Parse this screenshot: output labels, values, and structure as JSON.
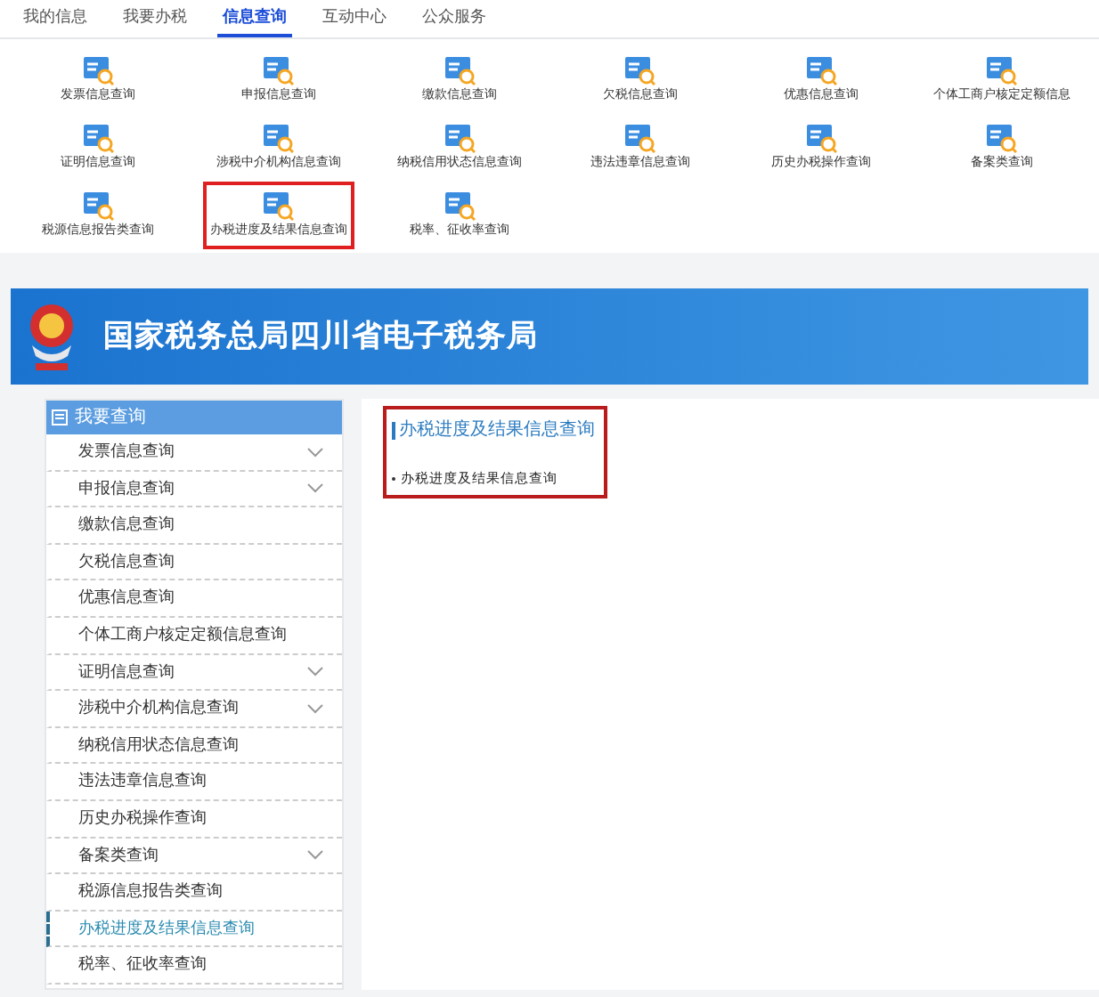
{
  "tabs": [
    {
      "label": "我的信息",
      "selected": false
    },
    {
      "label": "我要办税",
      "selected": false
    },
    {
      "label": "信息查询",
      "selected": true
    },
    {
      "label": "互动中心",
      "selected": false
    },
    {
      "label": "公众服务",
      "selected": false
    }
  ],
  "grid": [
    {
      "label": "发票信息查询",
      "highlighted": false
    },
    {
      "label": "申报信息查询",
      "highlighted": false
    },
    {
      "label": "缴款信息查询",
      "highlighted": false
    },
    {
      "label": "欠税信息查询",
      "highlighted": false
    },
    {
      "label": "优惠信息查询",
      "highlighted": false
    },
    {
      "label": "个体工商户核定定额信息",
      "highlighted": false
    },
    {
      "label": "证明信息查询",
      "highlighted": false
    },
    {
      "label": "涉税中介机构信息查询",
      "highlighted": false
    },
    {
      "label": "纳税信用状态信息查询",
      "highlighted": false
    },
    {
      "label": "违法违章信息查询",
      "highlighted": false
    },
    {
      "label": "历史办税操作查询",
      "highlighted": false
    },
    {
      "label": "备案类查询",
      "highlighted": false
    },
    {
      "label": "税源信息报告类查询",
      "highlighted": false
    },
    {
      "label": "办税进度及结果信息查询",
      "highlighted": true
    },
    {
      "label": "税率、征收率查询",
      "highlighted": false
    }
  ],
  "banner": {
    "title": "国家税务总局四川省电子税务局"
  },
  "sidebar": {
    "title": "我要查询",
    "items": [
      {
        "label": "发票信息查询",
        "expandable": true,
        "selected": false
      },
      {
        "label": "申报信息查询",
        "expandable": true,
        "selected": false
      },
      {
        "label": "缴款信息查询",
        "expandable": false,
        "selected": false
      },
      {
        "label": "欠税信息查询",
        "expandable": false,
        "selected": false
      },
      {
        "label": "优惠信息查询",
        "expandable": false,
        "selected": false
      },
      {
        "label": "个体工商户核定定额信息查询",
        "expandable": false,
        "selected": false
      },
      {
        "label": "证明信息查询",
        "expandable": true,
        "selected": false
      },
      {
        "label": "涉税中介机构信息查询",
        "expandable": true,
        "selected": false
      },
      {
        "label": "纳税信用状态信息查询",
        "expandable": false,
        "selected": false
      },
      {
        "label": "违法违章信息查询",
        "expandable": false,
        "selected": false
      },
      {
        "label": "历史办税操作查询",
        "expandable": false,
        "selected": false
      },
      {
        "label": "备案类查询",
        "expandable": true,
        "selected": false
      },
      {
        "label": "税源信息报告类查询",
        "expandable": false,
        "selected": false
      },
      {
        "label": "办税进度及结果信息查询",
        "expandable": false,
        "selected": true
      },
      {
        "label": "税率、征收率查询",
        "expandable": false,
        "selected": false
      }
    ]
  },
  "content": {
    "title": "办税进度及结果信息查询",
    "highlighted": true,
    "links": [
      "办税进度及结果信息查询"
    ]
  }
}
